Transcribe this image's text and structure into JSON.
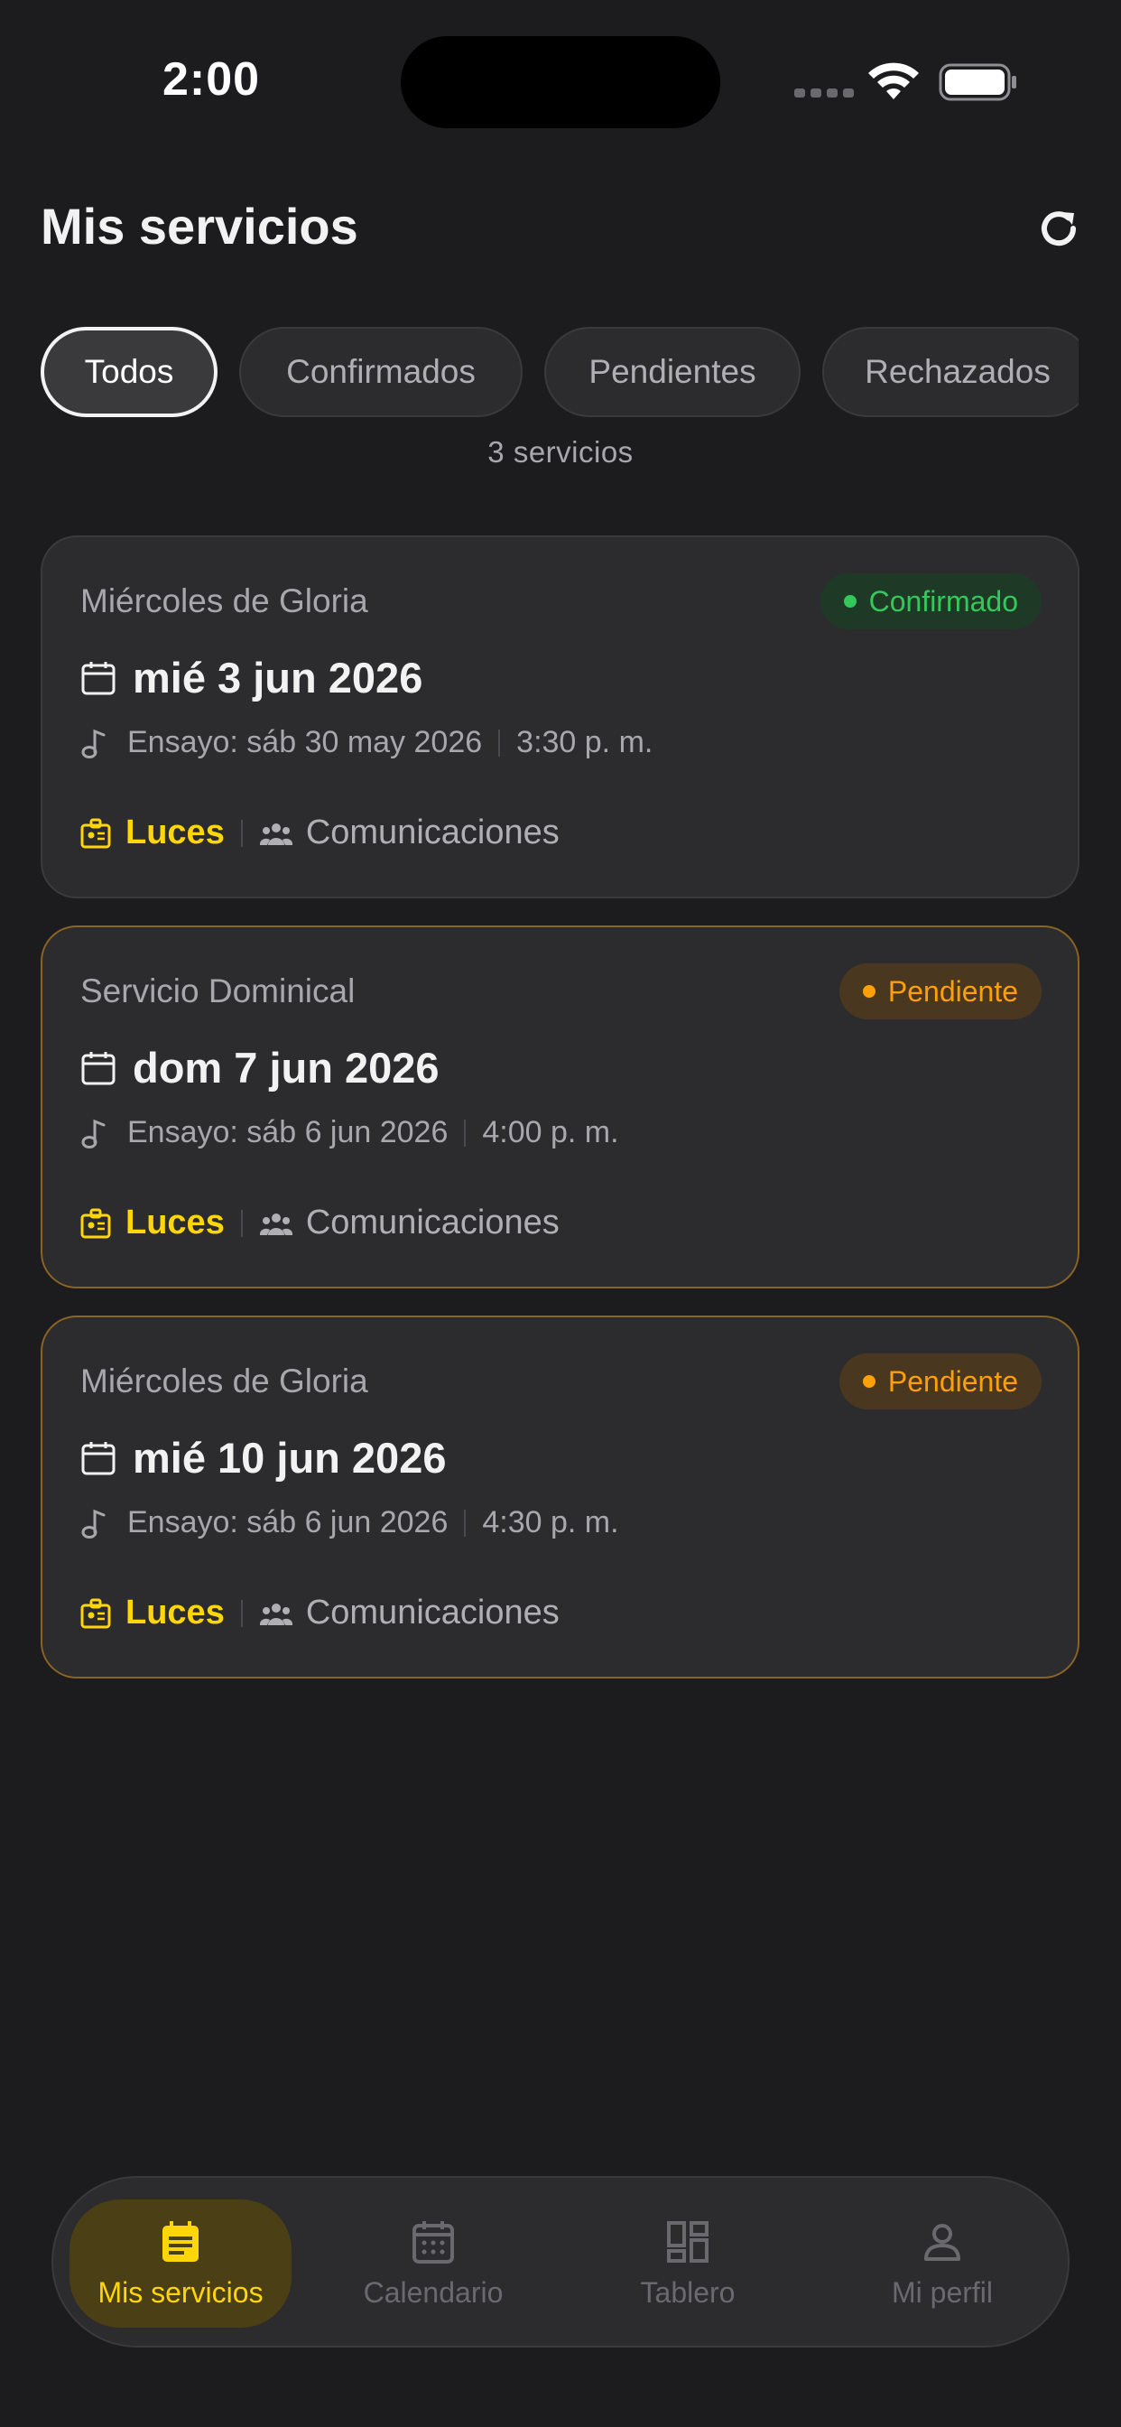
{
  "status_bar": {
    "time": "2:00"
  },
  "header": {
    "title": "Mis servicios",
    "refresh_icon": "refresh-icon"
  },
  "filters": [
    {
      "label": "Todos",
      "active": true
    },
    {
      "label": "Confirmados",
      "active": false
    },
    {
      "label": "Pendientes",
      "active": false
    },
    {
      "label": "Rechazados",
      "active": false
    }
  ],
  "count_text": "3 servicios",
  "services": [
    {
      "title": "Miércoles de Gloria",
      "status": "Confirmado",
      "date": "mié 3 jun 2026",
      "rehearsal": "Ensayo: sáb 30 may 2026",
      "time": "3:30 p. m.",
      "role": "Luces",
      "team": "Comunicaciones"
    },
    {
      "title": "Servicio Dominical",
      "status": "Pendiente",
      "date": "dom 7 jun 2026",
      "rehearsal": "Ensayo: sáb 6 jun 2026",
      "time": "4:00 p. m.",
      "role": "Luces",
      "team": "Comunicaciones"
    },
    {
      "title": "Miércoles de Gloria",
      "status": "Pendiente",
      "date": "mié 10 jun 2026",
      "rehearsal": "Ensayo: sáb 6 jun 2026",
      "time": "4:30 p. m.",
      "role": "Luces",
      "team": "Comunicaciones"
    }
  ],
  "tabs": [
    {
      "label": "Mis servicios",
      "icon": "list-icon",
      "active": true
    },
    {
      "label": "Calendario",
      "icon": "calendar-icon",
      "active": false
    },
    {
      "label": "Tablero",
      "icon": "dashboard-icon",
      "active": false
    },
    {
      "label": "Mi perfil",
      "icon": "profile-icon",
      "active": false
    }
  ],
  "colors": {
    "background": "#1c1c1e",
    "card": "#2c2c2e",
    "accent": "#ffd60a",
    "confirmed": "#34c759",
    "pending": "#ff9f0a"
  }
}
